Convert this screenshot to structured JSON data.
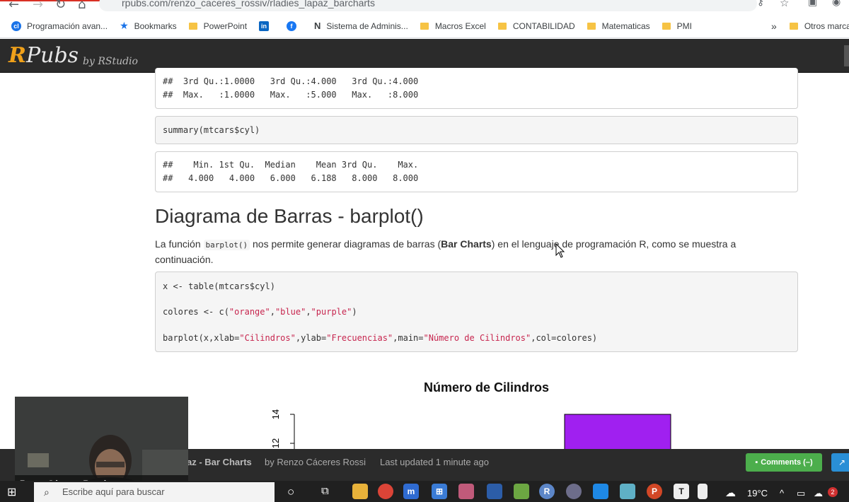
{
  "browser": {
    "url": "rpubs.com/renzo_caceres_rossiv/rladies_lapaz_barcharts",
    "bookmarks": [
      {
        "label": "Programación avan...",
        "icon": "cl-icon"
      },
      {
        "label": "Bookmarks",
        "icon": "star-icon"
      },
      {
        "label": "PowerPoint",
        "icon": "folder-icon"
      },
      {
        "label": "",
        "icon": "linkedin-icon"
      },
      {
        "label": "",
        "icon": "facebook-icon"
      },
      {
        "label": "Sistema de Adminis...",
        "icon": "n-icon"
      },
      {
        "label": "Macros Excel",
        "icon": "folder-icon"
      },
      {
        "label": "CONTABILIDAD",
        "icon": "folder-icon"
      },
      {
        "label": "Matematicas",
        "icon": "folder-icon"
      },
      {
        "label": "PMI",
        "icon": "folder-icon"
      }
    ],
    "overflow": "»",
    "other_bookmarks": "Otros marcad"
  },
  "rpubs": {
    "logo_r": "R",
    "logo_rest": "Pubs",
    "by": "by RStudio"
  },
  "content": {
    "output1_line1": "##  3rd Qu.:1.0000   3rd Qu.:4.000   3rd Qu.:4.000",
    "output1_line2": "##  Max.   :1.0000   Max.   :5.000   Max.   :8.000",
    "code1": "summary(mtcars$cyl)",
    "output2_line1": "##    Min. 1st Qu.  Median    Mean 3rd Qu.    Max.",
    "output2_line2": "##   4.000   4.000   6.000   6.188   8.000   8.000",
    "heading": "Diagrama de Barras - barplot()",
    "para_pre": "La función ",
    "para_code": "barplot()",
    "para_mid": " nos permite generar diagramas de barras (",
    "para_bold": "Bar Charts",
    "para_post": ") en el lenguaje de programación R, como se muestra a continuación.",
    "code2_line1": "x <- table(mtcars$cyl)",
    "code2_line2_pre": "colores <- c(",
    "code2_line2_s1": "\"orange\"",
    "code2_line2_s2": "\"blue\"",
    "code2_line2_s3": "\"purple\"",
    "code2_line2_post": ")",
    "code2_line3_pre": "barplot(x,xlab=",
    "code2_line3_s1": "\"Cilindros\"",
    "code2_line3_mid1": ",ylab=",
    "code2_line3_s2": "\"Frecuencias\"",
    "code2_line3_mid2": ",main=",
    "code2_line3_s3": "\"Número de Cilindros\"",
    "code2_line3_post": ",col=colores)",
    "comma": ","
  },
  "chart_data": {
    "type": "bar",
    "title": "Número de Cilindros",
    "yticks": [
      "12",
      "14"
    ],
    "visible_bar_color": "#a020f0"
  },
  "footer": {
    "title": "az - Bar Charts",
    "author": "by Renzo Cáceres Rossi",
    "updated": "Last updated 1 minute ago",
    "comments": "Comments (–)"
  },
  "webcam": {
    "name": "Renzo Cáceres Rossi"
  },
  "taskbar": {
    "search_placeholder": "Escribe aquí para buscar",
    "temperature": "19°C",
    "notification_count": "2"
  }
}
